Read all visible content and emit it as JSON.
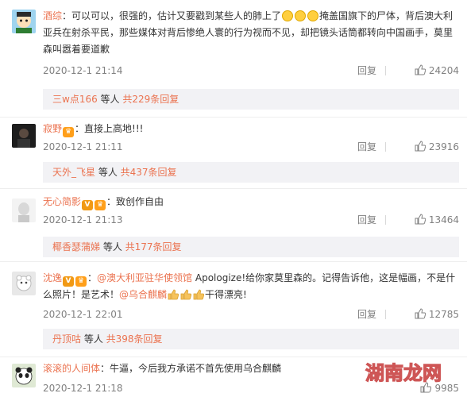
{
  "comments": [
    {
      "username": "酒综",
      "text_a": "：可以可以，很强的，估计又要戳到某些人的肺上了",
      "text_b": "掩盖国旗下的尸体，背后澳大利亚兵在射杀平民，那些媒体对背后惨绝人寰的行为视而不见，却把镜头话筒都转向中国画手，莫里森叫嚣着要道歉",
      "time": "2020-12-1 21:14",
      "reply_label": "回复",
      "likes": "24204",
      "sub_user": "三w点166",
      "sub_mid": " 等人 ",
      "sub_count": "共229条回复"
    },
    {
      "username": "寂野",
      "text_a": "：直接上高地!!!",
      "time": "2020-12-1 21:11",
      "reply_label": "回复",
      "likes": "23916",
      "sub_user": "天外_飞星",
      "sub_mid": " 等人 ",
      "sub_count": "共437条回复"
    },
    {
      "username": "无心简影",
      "text_a": "：致创作自由",
      "time": "2020-12-1 21:13",
      "reply_label": "回复",
      "likes": "13464",
      "sub_user": "椰香瑟蒲娣",
      "sub_mid": " 等人 ",
      "sub_count": "共177条回复"
    },
    {
      "username": "沈逸",
      "text_pre": "：",
      "mention_1": "@澳大利亚驻华使领馆",
      "text_a": " Apologize!给你家莫里森的。记得告诉他，这是幅画，不是什么照片！是艺术！",
      "mention_2": "@乌合麒麟",
      "text_b": "干得漂亮!",
      "time": "2020-12-1 22:01",
      "reply_label": "回复",
      "likes": "12785",
      "sub_user": "丹顶咕",
      "sub_mid": " 等人 ",
      "sub_count": "共398条回复"
    },
    {
      "username": "滚滚的人间体",
      "text_a": "：牛逼，今后我方承诺不首先使用乌合麒麟",
      "time": "2020-12-1 21:18",
      "likes": "9985"
    }
  ],
  "watermark": "湖南龙网",
  "colors": {
    "link": "#eb7350",
    "meta": "#808080",
    "subbox_bg": "#f2f2f5"
  }
}
